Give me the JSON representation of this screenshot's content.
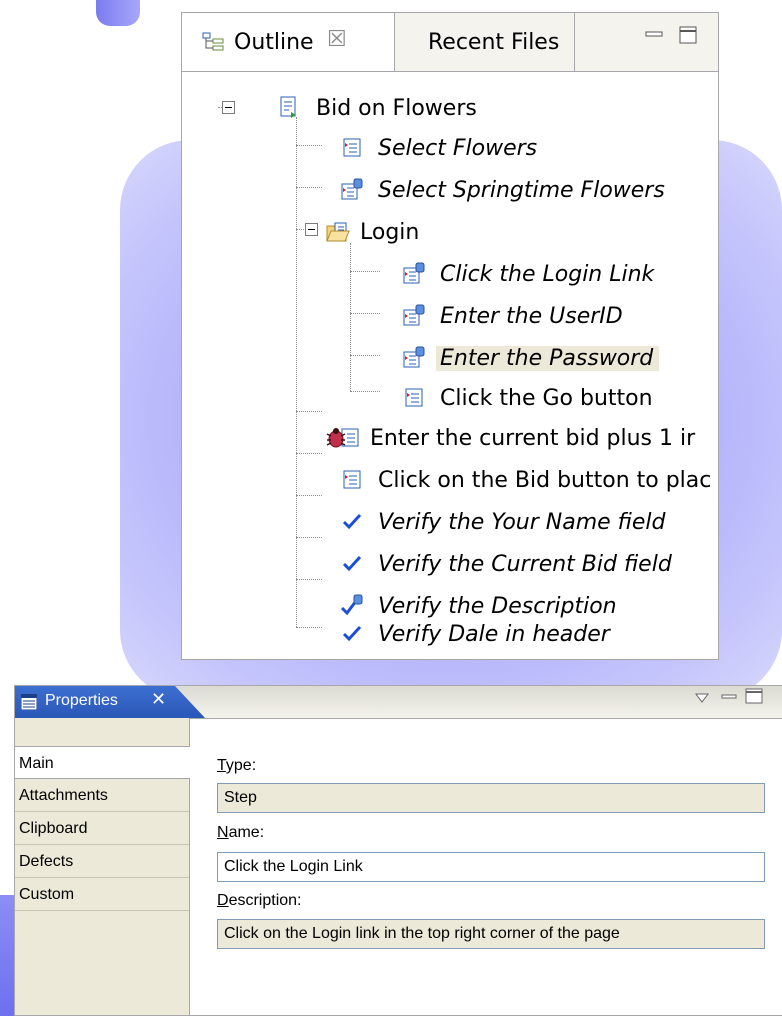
{
  "outline_view": {
    "tabs": [
      {
        "label": "Outline",
        "icon": "outline-icon",
        "close": "☒"
      },
      {
        "label": "Recent Files"
      }
    ],
    "tree": [
      {
        "label": "Bid on Flowers",
        "icon": "test-script-icon",
        "italic": false
      },
      {
        "label": "Select Flowers",
        "icon": "step-icon",
        "italic": true
      },
      {
        "label": "Select Springtime Flowers",
        "icon": "step-linked-icon",
        "italic": true
      },
      {
        "label": "Login",
        "icon": "folder-open-icon",
        "italic": false
      },
      {
        "label": "Click the Login Link",
        "icon": "step-linked-icon",
        "italic": true
      },
      {
        "label": "Enter the UserID",
        "icon": "step-linked-icon",
        "italic": true
      },
      {
        "label": "Enter the Password",
        "icon": "step-linked-icon",
        "italic": true,
        "selected": true
      },
      {
        "label": "Click the Go button",
        "icon": "step-icon",
        "italic": false
      },
      {
        "label": "Enter the current bid plus 1 ir",
        "icon": "step-defect-icon",
        "italic": false
      },
      {
        "label": "Click on the Bid button to plac",
        "icon": "step-icon",
        "italic": false
      },
      {
        "label": "Verify the Your Name field",
        "icon": "checkmark-icon",
        "italic": true
      },
      {
        "label": "Verify the Current Bid field",
        "icon": "checkmark-icon",
        "italic": true
      },
      {
        "label": "Verify the Description",
        "icon": "checkmark-linked-icon",
        "italic": true
      },
      {
        "label": "Verify Dale in header",
        "icon": "checkmark-icon",
        "italic": true
      }
    ]
  },
  "properties_view": {
    "tab_label": "Properties",
    "tab_close": "✕",
    "side_tabs": [
      "Main",
      "Attachments",
      "Clipboard",
      "Defects",
      "Custom"
    ],
    "active_side_tab": "Main",
    "fields": {
      "type": {
        "label_first": "T",
        "label_rest": "ype:",
        "value": "Step"
      },
      "name": {
        "label_first": "N",
        "label_rest": "ame:",
        "value": "Click the Login Link"
      },
      "description": {
        "label_first": "D",
        "label_rest": "escription:",
        "value": "Click on the Login link in the top right corner of the page"
      }
    }
  },
  "colors": {
    "accent_blue": "#2a57b8",
    "background_purple": "#9c9cf8",
    "check_blue": "#1a4fd6",
    "panel_gray": "#ece9d8"
  }
}
